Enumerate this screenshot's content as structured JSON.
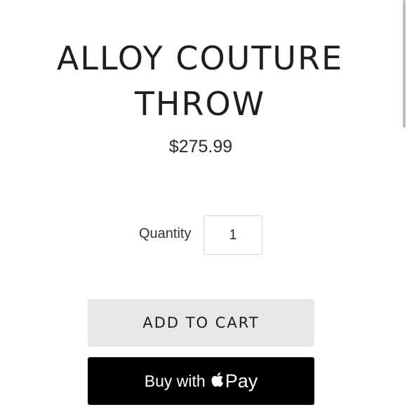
{
  "product": {
    "title_line1": "ALLOY COUTURE",
    "title_line2": "THROW",
    "price": "$275.99"
  },
  "quantity": {
    "label": "Quantity",
    "value": "1"
  },
  "buttons": {
    "add_to_cart": "ADD TO CART",
    "buy_with": "Buy with",
    "pay": "Pay"
  },
  "icons": {
    "apple_pay_logo": "apple-icon"
  },
  "colors": {
    "add_to_cart_bg": "#e7e7e7",
    "apple_pay_bg": "#000000"
  }
}
